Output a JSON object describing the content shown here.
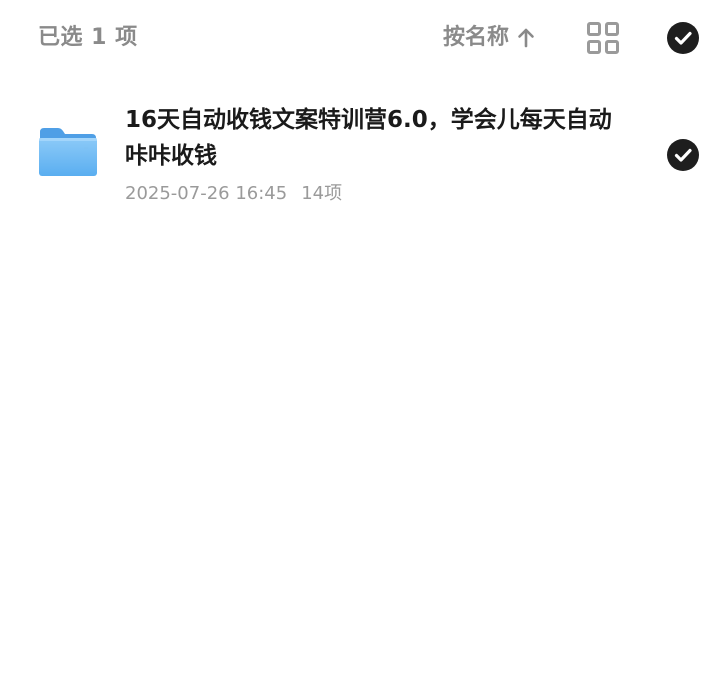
{
  "header": {
    "selected_text": "已选 1 项",
    "sort_label": "按名称",
    "sort_direction_icon": "arrow-up-icon",
    "view_toggle_icon": "grid-view-icon",
    "select_all_icon": "check-circle-icon"
  },
  "files": [
    {
      "name": "16天自动收钱文案特训营6.0，学会儿每天自动咔咔收钱",
      "date": "2025-07-26 16:45",
      "count": "14项",
      "type_icon": "folder-icon",
      "selected": true
    }
  ],
  "colors": {
    "muted_text": "#8a8a8a",
    "primary_text": "#1a1a1a",
    "check_fill": "#1e1e1e",
    "folder_blue": "#5aaef0"
  }
}
